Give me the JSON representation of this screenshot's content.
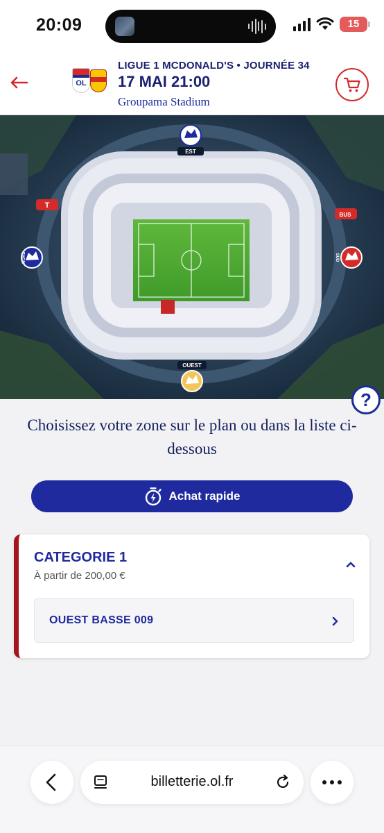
{
  "status_bar": {
    "time": "20:09",
    "battery": "15"
  },
  "header": {
    "competition": "LIGUE 1 MCDONALD'S • JOURNÉE 34",
    "date": "17 MAI 21:00",
    "venue": "Groupama Stadium"
  },
  "map": {
    "labels": {
      "est": "EST",
      "ouest": "OUEST",
      "tram": "T",
      "bus": "BUS",
      "nord": "NORD",
      "sud": "SUD"
    }
  },
  "instructions": "Choisissez votre zone sur le plan ou dans la liste ci-dessous",
  "quick_buy_label": "Achat rapide",
  "category": {
    "title": "CATEGORIE 1",
    "price": "À partir de 200,00 €",
    "zones": [
      {
        "label": "OUEST BASSE 009"
      }
    ]
  },
  "browser": {
    "url": "billetterie.ol.fr"
  },
  "colors": {
    "brand_blue": "#1e2a9e",
    "brand_red": "#d42a2a",
    "card_accent": "#a6131a"
  },
  "icons": {
    "back": "arrow-left-icon",
    "cart": "cart-icon",
    "help": "question-icon",
    "quick_buy": "stopwatch-bolt-icon",
    "expand": "chevron-up-icon",
    "zone": "chevron-right-icon",
    "browser_back": "chevron-left-icon",
    "reader": "reader-icon",
    "reload": "reload-icon",
    "more": "more-icon"
  }
}
